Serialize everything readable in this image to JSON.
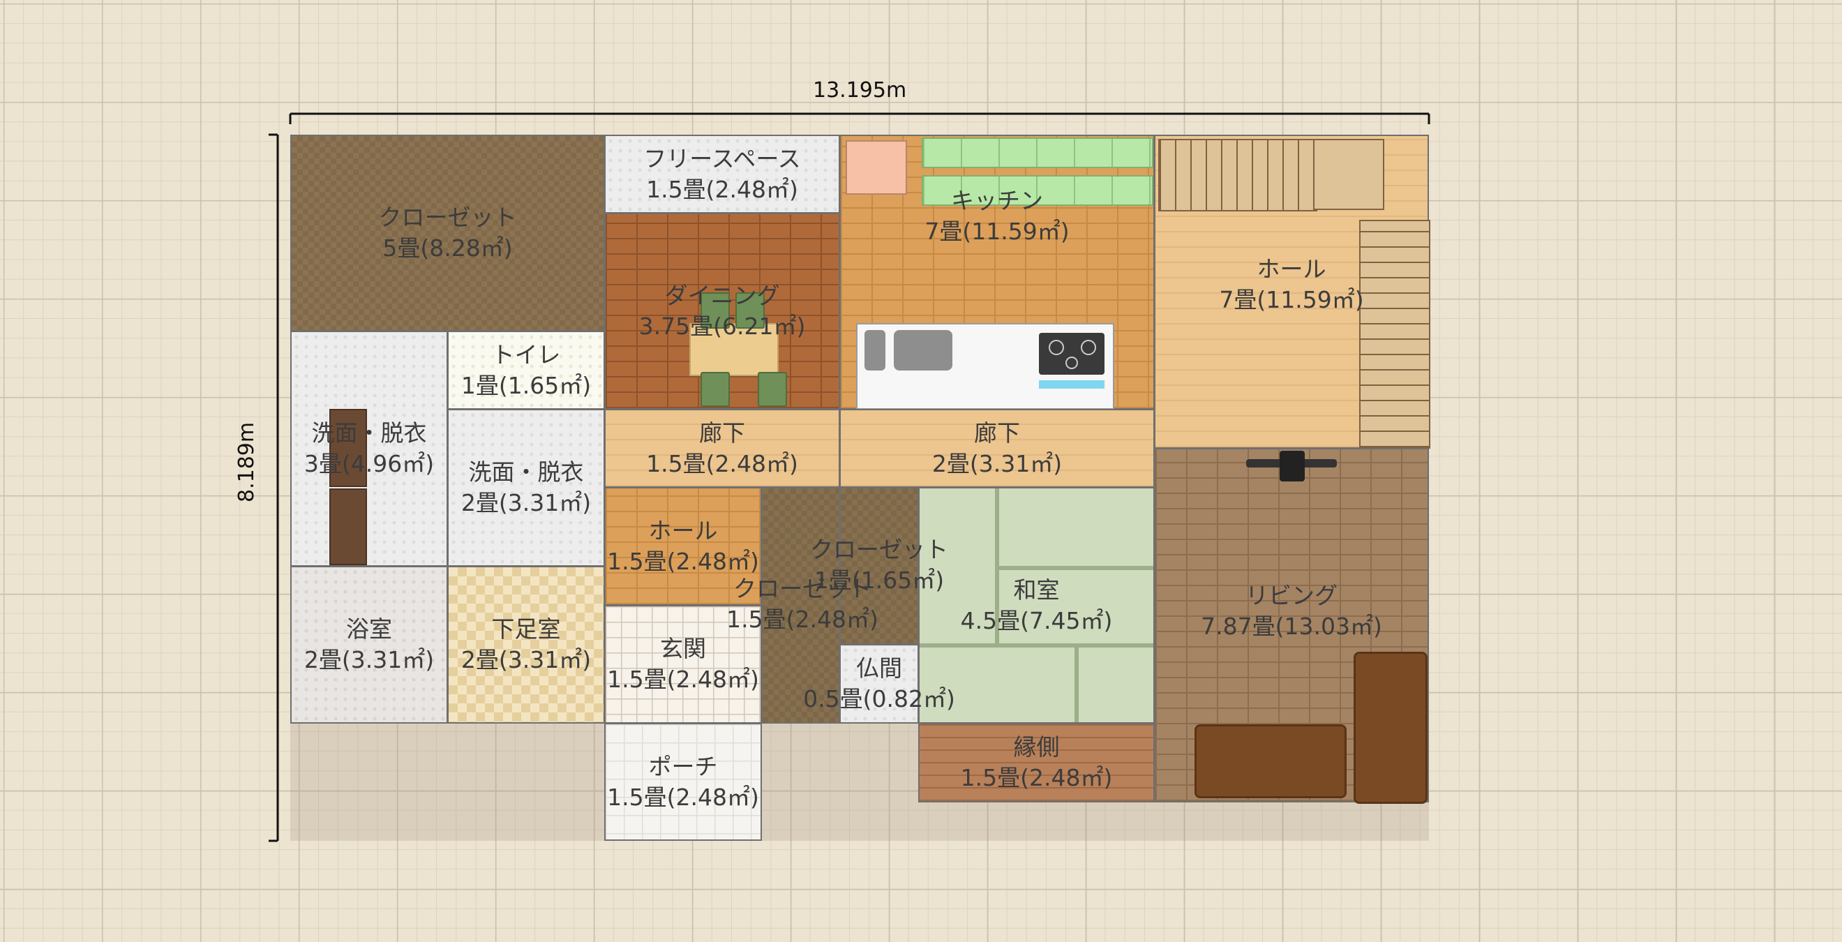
{
  "dimensions": {
    "width": "13.195m",
    "height": "8.189m"
  },
  "rooms": {
    "closet_big": {
      "name": "クローゼット",
      "area": "5畳(8.28㎡)"
    },
    "free_space": {
      "name": "フリースペース",
      "area": "1.5畳(2.48㎡)"
    },
    "kitchen": {
      "name": "キッチン",
      "area": "7畳(11.59㎡)"
    },
    "hall_upper": {
      "name": "ホール",
      "area": "7畳(11.59㎡)"
    },
    "dining": {
      "name": "ダイニング",
      "area": "3.75畳(6.21㎡)"
    },
    "toilet": {
      "name": "トイレ",
      "area": "1畳(1.65㎡)"
    },
    "washroom_a": {
      "name": "洗面・脱衣",
      "area": "3畳(4.96㎡)"
    },
    "washroom_b": {
      "name": "洗面・脱衣",
      "area": "2畳(3.31㎡)"
    },
    "corridor_a": {
      "name": "廊下",
      "area": "1.5畳(2.48㎡)"
    },
    "corridor_b": {
      "name": "廊下",
      "area": "2畳(3.31㎡)"
    },
    "hall_lower": {
      "name": "ホール",
      "area": "1.5畳(2.48㎡)"
    },
    "closet_small": {
      "name": "クローゼット",
      "area": "1畳(1.65㎡)"
    },
    "closet_mid": {
      "name": "クローゼット",
      "area": "1.5畳(2.48㎡)"
    },
    "washitsu": {
      "name": "和室",
      "area": "4.5畳(7.45㎡)"
    },
    "living": {
      "name": "リビング",
      "area": "7.87畳(13.03㎡)"
    },
    "bathroom": {
      "name": "浴室",
      "area": "2畳(3.31㎡)"
    },
    "geta_room": {
      "name": "下足室",
      "area": "2畳(3.31㎡)"
    },
    "entrance": {
      "name": "玄関",
      "area": "1.5畳(2.48㎡)"
    },
    "butsuma": {
      "name": "仏間",
      "area": "0.5畳(0.82㎡)"
    },
    "engawa": {
      "name": "縁側",
      "area": "1.5畳(2.48㎡)"
    },
    "porch": {
      "name": "ポーチ",
      "area": "1.5畳(2.48㎡)"
    }
  }
}
